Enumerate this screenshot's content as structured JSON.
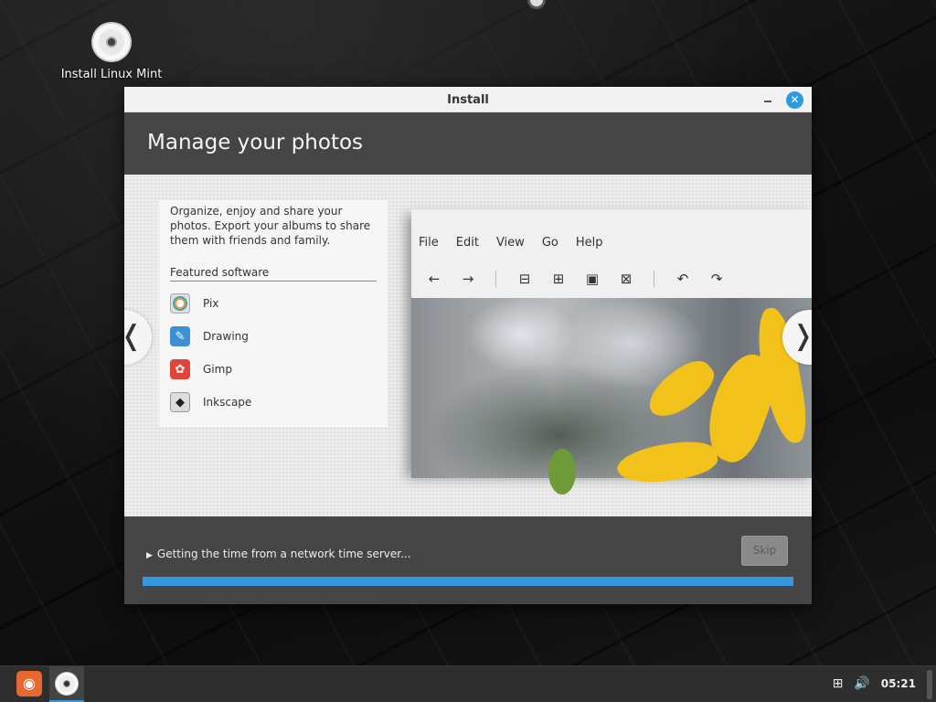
{
  "desktop": {
    "icon_label": "Install Linux Mint",
    "icon_name": "disc-icon"
  },
  "window": {
    "title": "Install",
    "controls": {
      "minimize": "minimize-icon",
      "close": "close-icon",
      "close_glyph": "✕"
    },
    "slide": {
      "title": "Manage your photos",
      "description": "Organize, enjoy and share your photos. Export your albums to share them with friends and family.",
      "featured_heading": "Featured software",
      "software": [
        {
          "label": "Pix",
          "icon": "pix-icon",
          "glyph": ""
        },
        {
          "label": "Drawing",
          "icon": "drawing-icon",
          "glyph": "✎"
        },
        {
          "label": "Gimp",
          "icon": "gimp-icon",
          "glyph": "✿"
        },
        {
          "label": "Inkscape",
          "icon": "inkscape-icon",
          "glyph": "◆"
        }
      ],
      "screenshot": {
        "menu": [
          "File",
          "Edit",
          "View",
          "Go",
          "Help"
        ],
        "toolbar": [
          "←",
          "→",
          "⊟",
          "⊞",
          "▣",
          "⊠",
          "↶",
          "↷"
        ]
      },
      "nav": {
        "prev": "❬",
        "next": "❭"
      }
    },
    "footer": {
      "status": "Getting the time from a network time server...",
      "status_caret": "▶",
      "skip_label": "Skip",
      "progress_fraction": 1.0
    }
  },
  "taskbar": {
    "menu_glyph": "◉",
    "clock": "05:21",
    "tray_icons": [
      "network-icon",
      "volume-icon"
    ],
    "network_glyph": "⊞",
    "volume_glyph": "🔊"
  },
  "colors": {
    "accent": "#3498db",
    "window_bg": "#454545",
    "menu_orange": "#e8692f"
  }
}
